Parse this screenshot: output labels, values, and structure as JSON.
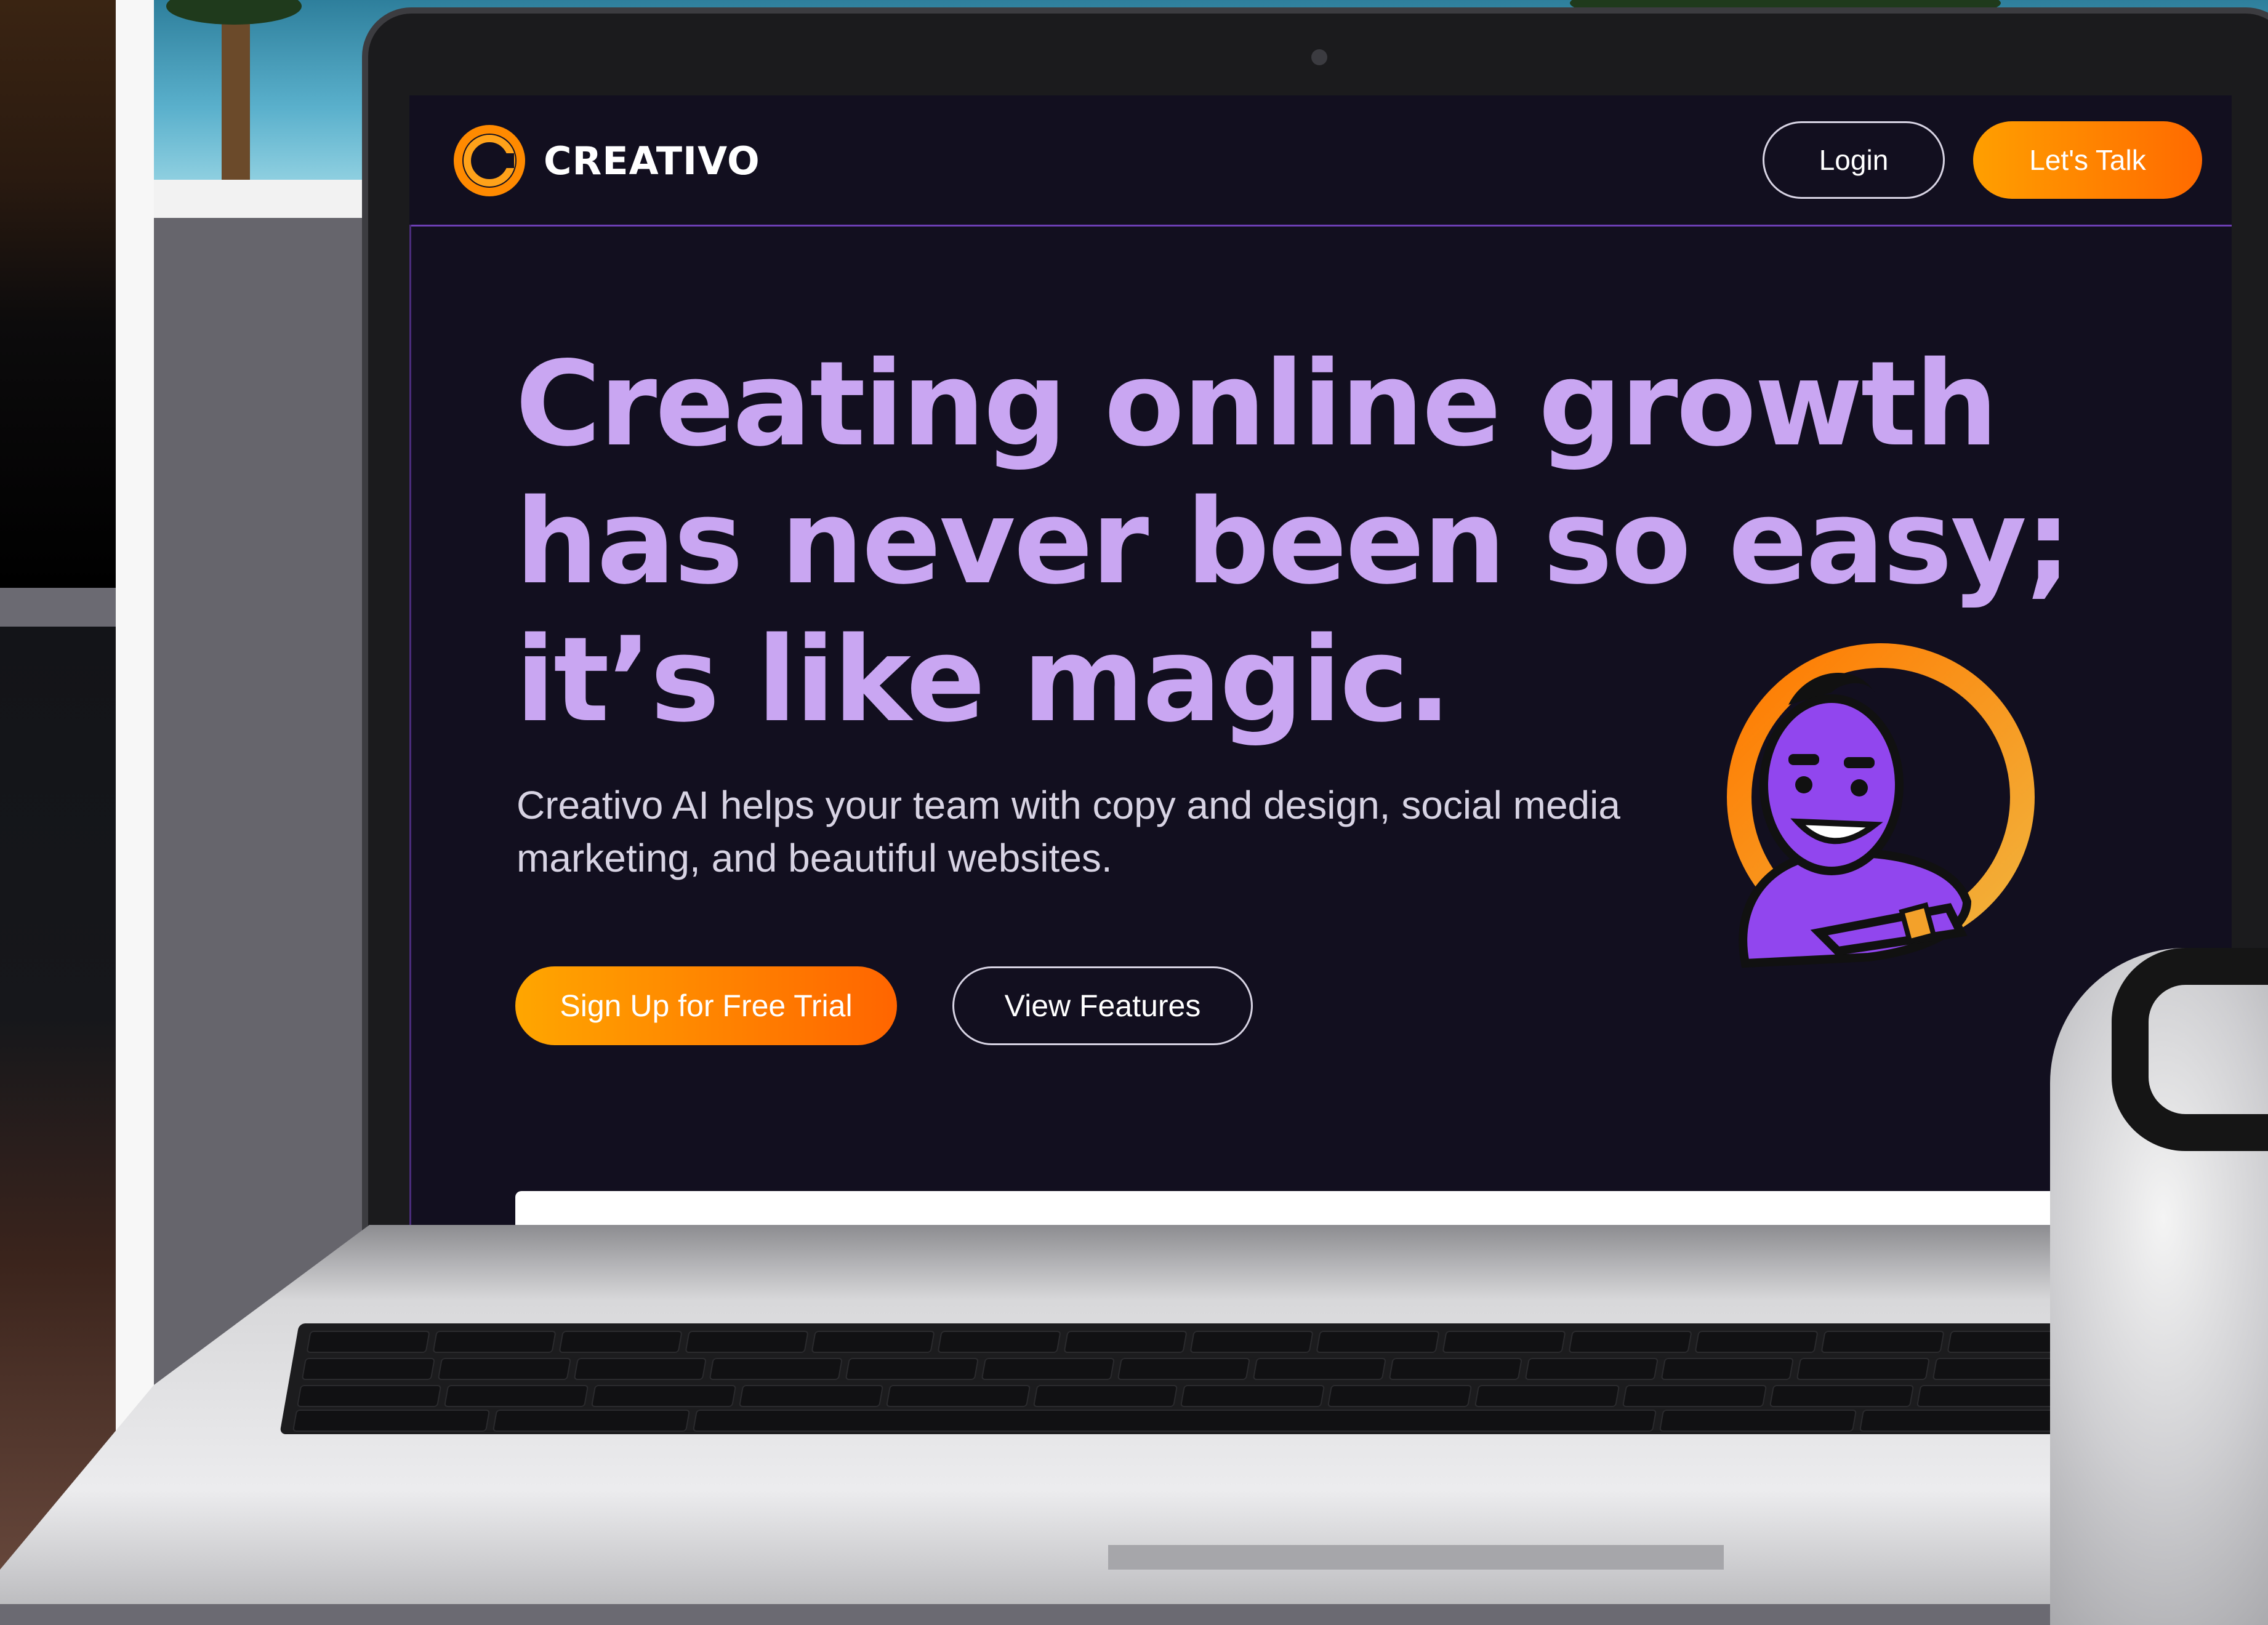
{
  "nav": {
    "brand": "CREATIVO",
    "login_label": "Login",
    "cta_label": "Let's Talk"
  },
  "hero": {
    "headline": "Creating online growth has never been so easy; it’s like magic.",
    "subtext": "Creativo AI helps your team with copy and design, social media marketing, and beautiful websites.",
    "primary_button": "Sign Up for Free Trial",
    "secondary_button": "View Features"
  },
  "icons": {
    "logo": "creativo-logo-icon",
    "mascot": "genie-mascot-icon"
  },
  "colors": {
    "background": "#120f1f",
    "headline": "#c9a6f2",
    "accent_start": "#ffa600",
    "accent_end": "#ff6500",
    "divider": "#6d3fb5"
  }
}
